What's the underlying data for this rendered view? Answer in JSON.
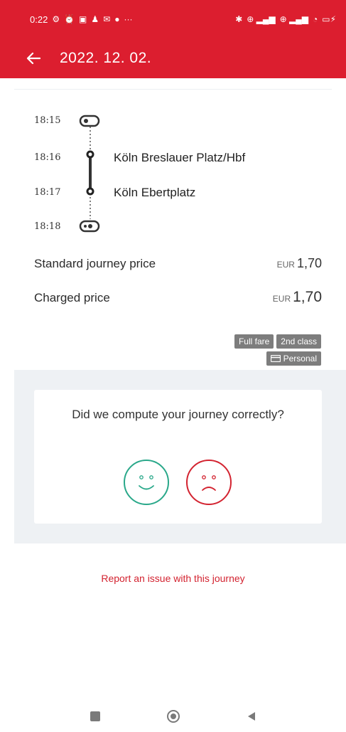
{
  "status_bar": {
    "time": "0:22",
    "left_icons": [
      "notification-icon",
      "alarm-icon",
      "nfc-icon",
      "activity-icon",
      "mail-icon",
      "dot-icon"
    ],
    "ellipsis": "···",
    "right_icons": [
      "bluetooth-icon",
      "signal-icon",
      "signal-icon",
      "wifi-icon",
      "battery-icon"
    ]
  },
  "app_bar": {
    "title": "2022. 12. 02."
  },
  "journey": {
    "stops": [
      {
        "time": "18:15",
        "name": ""
      },
      {
        "time": "18:16",
        "name": "Köln Breslauer Platz/Hbf"
      },
      {
        "time": "18:17",
        "name": "Köln Ebertplatz"
      },
      {
        "time": "18:18",
        "name": ""
      }
    ]
  },
  "prices": {
    "standard_label": "Standard journey price",
    "standard_currency": "EUR",
    "standard_value": "1,70",
    "charged_label": "Charged price",
    "charged_currency": "EUR",
    "charged_value": "1,70"
  },
  "tags": {
    "fare": "Full fare",
    "class": "2nd class",
    "card": "Personal"
  },
  "feedback": {
    "question": "Did we compute your journey correctly?",
    "positive_color": "#2aa88a",
    "negative_color": "#d32330"
  },
  "report": {
    "label": "Report an issue with this journey"
  },
  "colors": {
    "brand": "#dc1e2f",
    "tag_bg": "#7d7d7d"
  }
}
